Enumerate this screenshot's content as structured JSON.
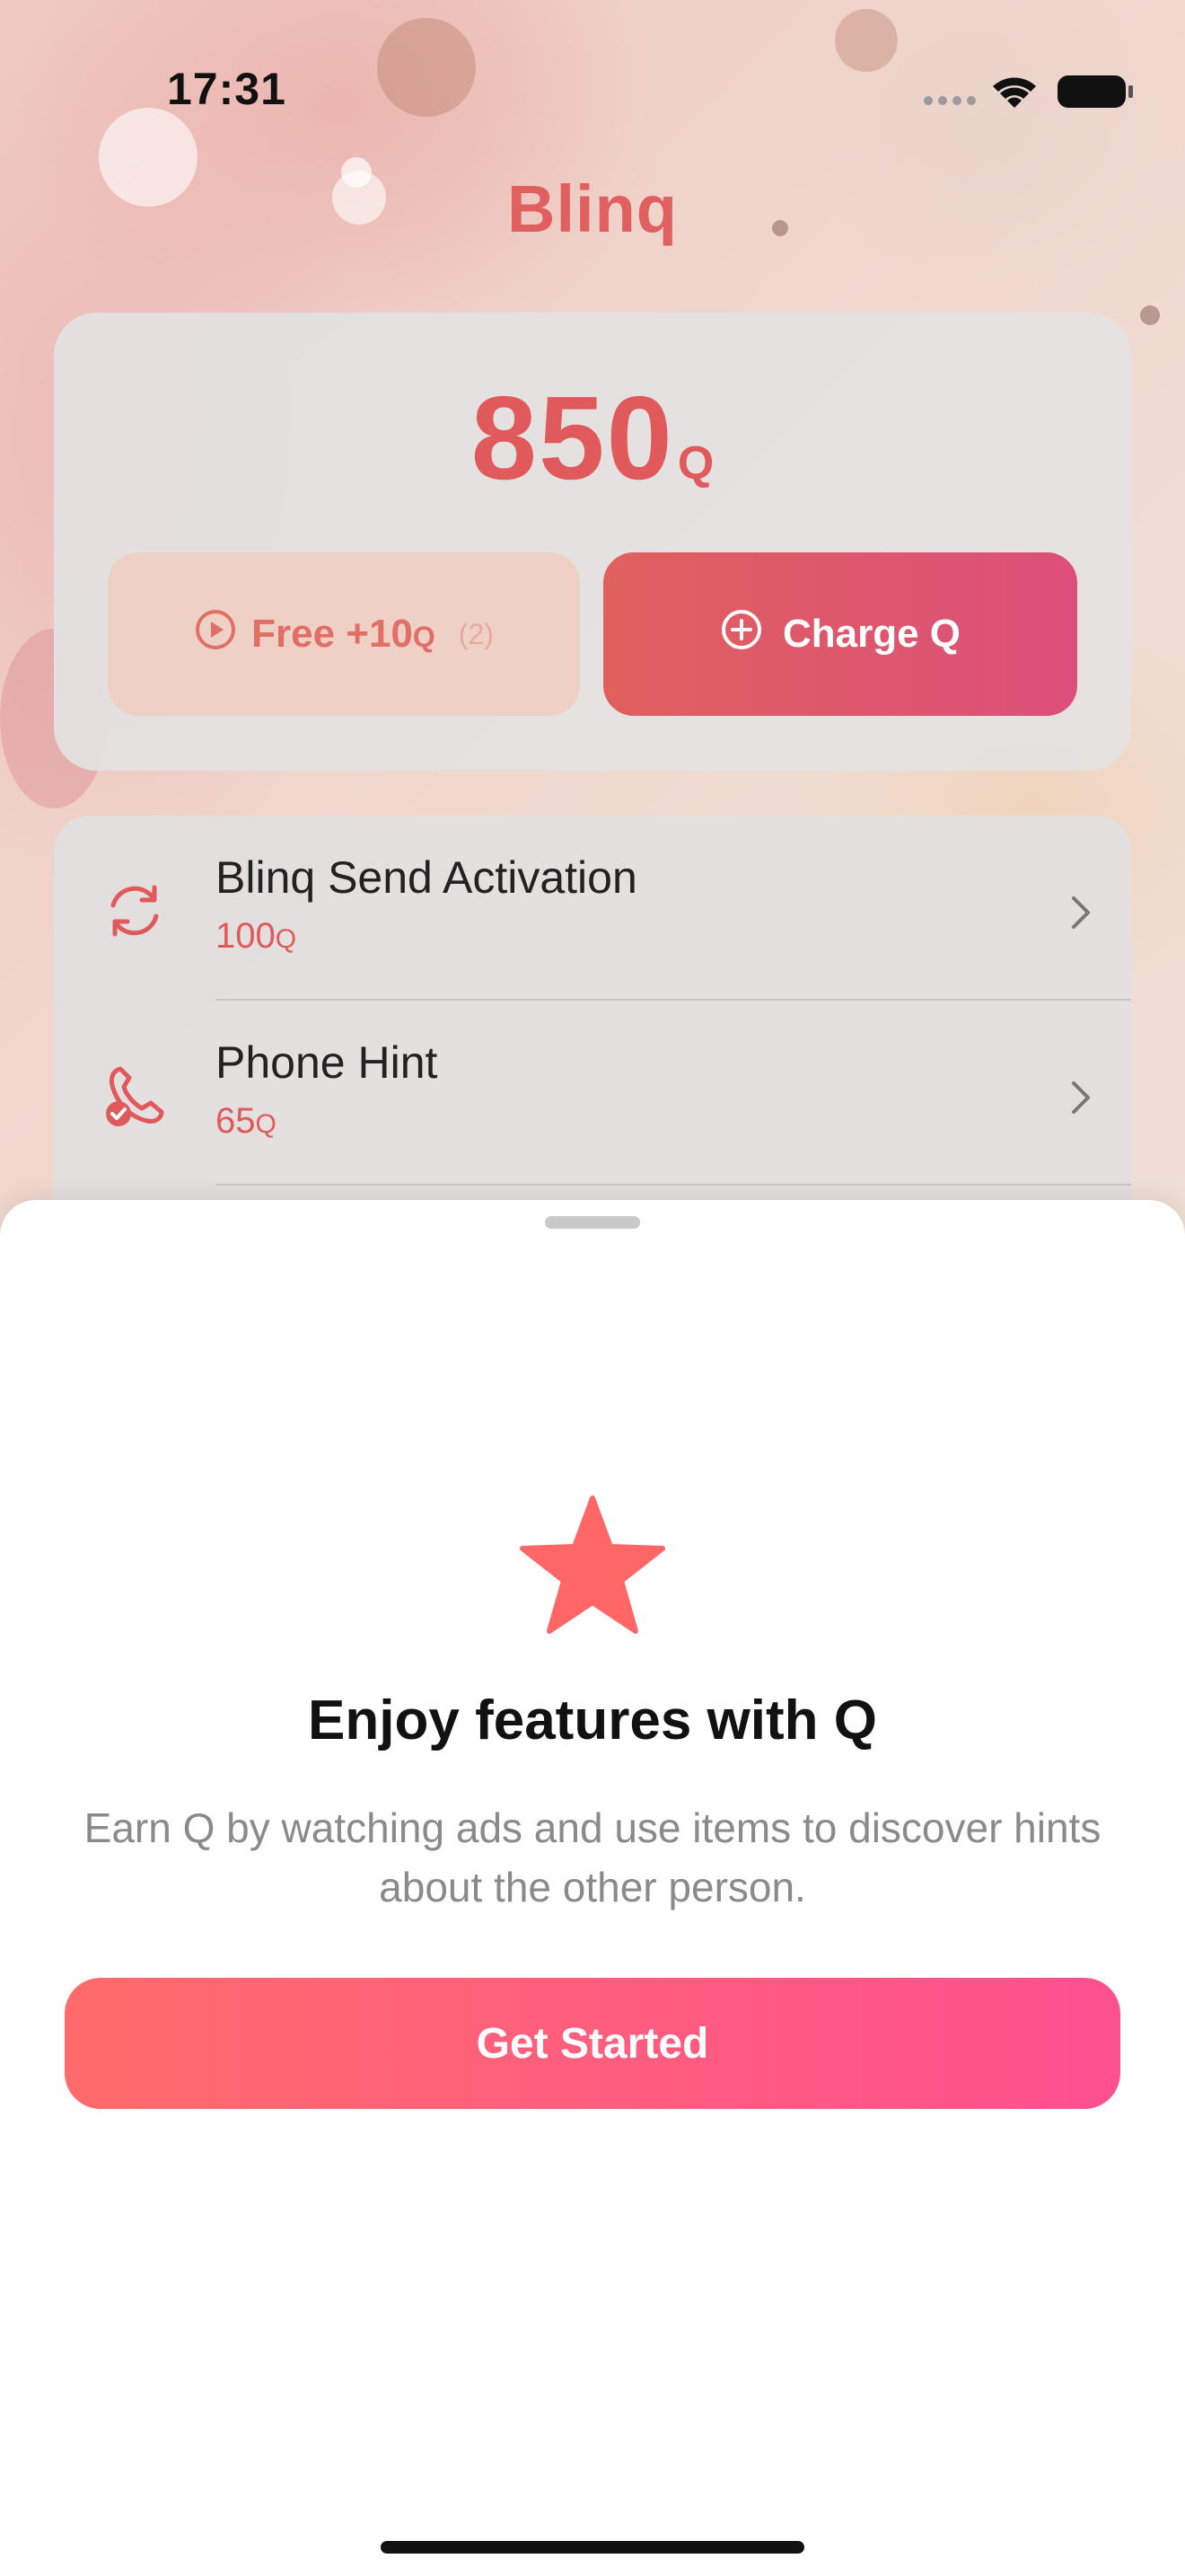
{
  "status_bar": {
    "time": "17:31"
  },
  "app": {
    "logo": "Blinq"
  },
  "balance": {
    "amount": "850",
    "unit": "Q"
  },
  "actions": {
    "free": {
      "label": "Free +10",
      "unit": "Q",
      "count": "(2)",
      "icon": "play-circle-icon"
    },
    "charge": {
      "label": "Charge Q",
      "icon": "plus-circle-icon"
    }
  },
  "items": [
    {
      "title": "Blinq Send Activation",
      "price": "100",
      "unit": "Q",
      "icon": "refresh-icon"
    },
    {
      "title": "Phone Hint",
      "price": "65",
      "unit": "Q",
      "icon": "phone-check-icon"
    }
  ],
  "sheet": {
    "title": "Enjoy features with Q",
    "description": "Earn Q by watching ads and use items to discover hints about the other person.",
    "cta": "Get Started",
    "icon": "star-icon"
  },
  "colors": {
    "accent": "#e05a5c",
    "cta_start": "#ff6b6b",
    "cta_end": "#ff5090",
    "star": "#ff6666"
  }
}
